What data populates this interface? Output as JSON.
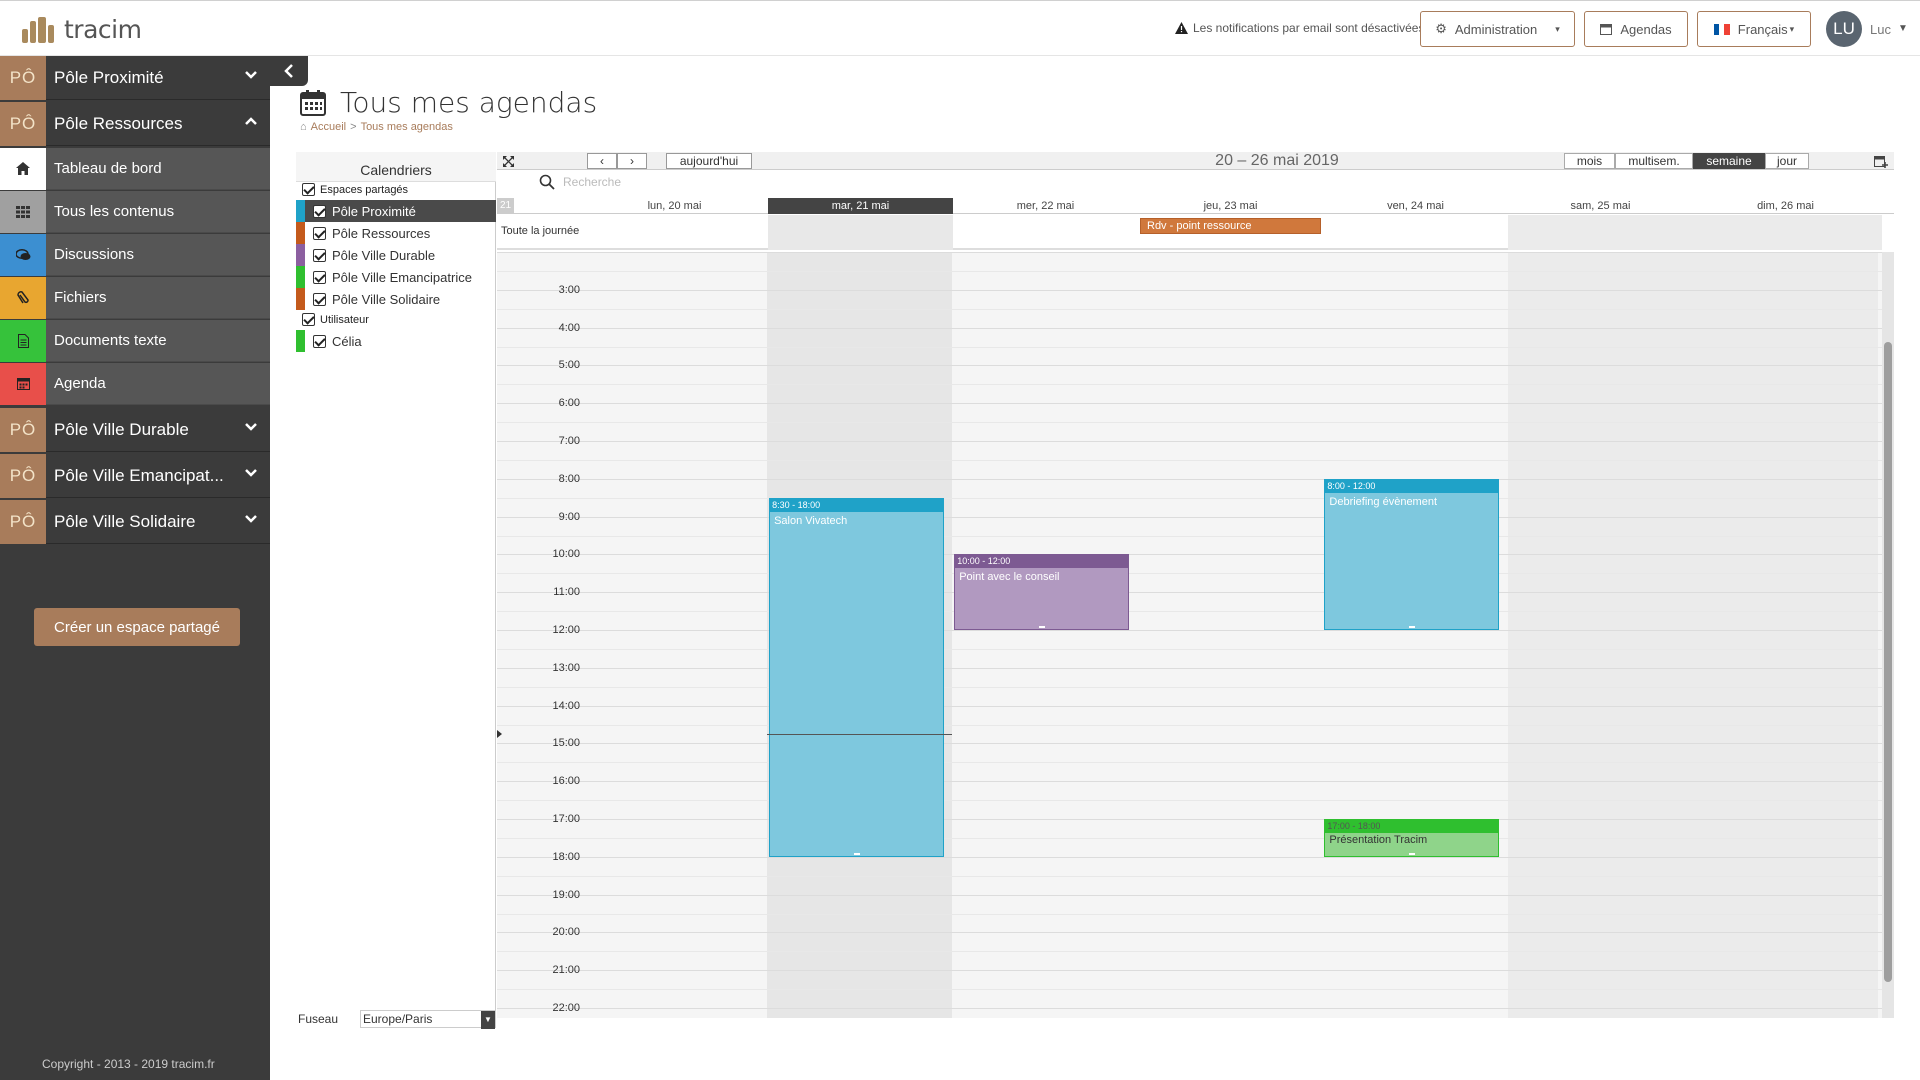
{
  "header": {
    "logo_text": "tracim",
    "notification": "Les notifications par email sont désactivées",
    "admin_label": "Administration",
    "agendas_label": "Agendas",
    "language_label": "Français",
    "avatar_initials": "LU",
    "username": "Luc"
  },
  "sidebar": {
    "workspaces": [
      {
        "badge": "PÔ",
        "name": "Pôle Proximité",
        "expanded": false
      },
      {
        "badge": "PÔ",
        "name": "Pôle Ressources",
        "expanded": true
      },
      {
        "badge": "PÔ",
        "name": "Pôle Ville Durable",
        "expanded": false
      },
      {
        "badge": "PÔ",
        "name": "Pôle Ville Emancipat...",
        "expanded": false
      },
      {
        "badge": "PÔ",
        "name": "Pôle Ville Solidaire",
        "expanded": false
      }
    ],
    "subitems": [
      {
        "label": "Tableau de bord",
        "icon": "home-icon",
        "color": "#ffffff"
      },
      {
        "label": "Tous les contenus",
        "icon": "grid-icon",
        "color": "#a0a0a0"
      },
      {
        "label": "Discussions",
        "icon": "comments-icon",
        "color": "#3c8fd1"
      },
      {
        "label": "Fichiers",
        "icon": "paperclip-icon",
        "color": "#e8a630"
      },
      {
        "label": "Documents texte",
        "icon": "file-text-icon",
        "color": "#36c23b"
      },
      {
        "label": "Agenda",
        "icon": "calendar-icon",
        "color": "#e84f4a"
      }
    ],
    "create_button": "Créer un espace partagé",
    "copyright": "Copyright - 2013 - 2019    tracim.fr"
  },
  "page": {
    "title": "Tous mes agendas",
    "breadcrumb": [
      "Accueil",
      ">",
      "Tous mes agendas"
    ]
  },
  "calendars": {
    "header": "Calendriers",
    "groups": [
      {
        "label": "Espaces partagés",
        "items": [
          {
            "name": "Pôle Proximité",
            "color": "#1fa2c8",
            "active": true
          },
          {
            "name": "Pôle Ressources",
            "color": "#c45a1c",
            "active": false
          },
          {
            "name": "Pôle Ville Durable",
            "color": "#8c5fa0",
            "active": false
          },
          {
            "name": "Pôle Ville Emancipatrice",
            "color": "#2fbf2f",
            "active": false
          },
          {
            "name": "Pôle Ville Solidaire",
            "color": "#c45a1c",
            "active": false
          }
        ]
      },
      {
        "label": "Utilisateur",
        "items": [
          {
            "name": "Célia",
            "color": "#2fbf2f",
            "active": false
          }
        ]
      }
    ],
    "timezone_label": "Fuseau",
    "timezone_value": "Europe/Paris"
  },
  "calendar": {
    "today_button": "aujourd'hui",
    "range": "20 – 26 mai 2019",
    "views": [
      {
        "label": "mois",
        "active": false
      },
      {
        "label": "multisem.",
        "active": false
      },
      {
        "label": "semaine",
        "active": true
      },
      {
        "label": "jour",
        "active": false
      }
    ],
    "search_placeholder": "Recherche",
    "week_number": "21",
    "all_day_label": "Toute la journée",
    "days": [
      {
        "label": "lun, 20 mai",
        "today": false,
        "weekend": false
      },
      {
        "label": "mar, 21 mai",
        "today": true,
        "weekend": false
      },
      {
        "label": "mer, 22 mai",
        "today": false,
        "weekend": false
      },
      {
        "label": "jeu, 23 mai",
        "today": false,
        "weekend": false
      },
      {
        "label": "ven, 24 mai",
        "today": false,
        "weekend": false
      },
      {
        "label": "sam, 25 mai",
        "today": false,
        "weekend": true
      },
      {
        "label": "dim, 26 mai",
        "today": false,
        "weekend": true
      }
    ],
    "hours": [
      "3:00",
      "4:00",
      "5:00",
      "6:00",
      "7:00",
      "8:00",
      "9:00",
      "10:00",
      "11:00",
      "12:00",
      "13:00",
      "14:00",
      "15:00",
      "16:00",
      "17:00",
      "18:00",
      "19:00",
      "20:00",
      "21:00",
      "22:00"
    ],
    "all_day_events": [
      {
        "day": 3,
        "title": "Rdv - point ressource",
        "color": "#d0783c"
      }
    ],
    "events": [
      {
        "day": 1,
        "start": 8.5,
        "end": 18,
        "time": "8:30 - 18:00",
        "title": "Salon Vivatech",
        "color": "#7ec8de",
        "bar": "#1fa2c8"
      },
      {
        "day": 2,
        "start": 10,
        "end": 12,
        "time": "10:00 - 12:00",
        "title": "Point avec le conseil",
        "color": "#b199c0",
        "bar": "#7d5a92"
      },
      {
        "day": 4,
        "start": 8,
        "end": 12,
        "time": "8:00 - 12:00",
        "title": "Debriefing évènement",
        "color": "#7ec8de",
        "bar": "#1fa2c8"
      },
      {
        "day": 4,
        "start": 17,
        "end": 18,
        "time": "17:00 - 18:00",
        "title": "Présentation Tracim",
        "color": "#8fd48a",
        "bar": "#2fbf2f",
        "dark": true
      }
    ],
    "now_hour": 14.75
  }
}
